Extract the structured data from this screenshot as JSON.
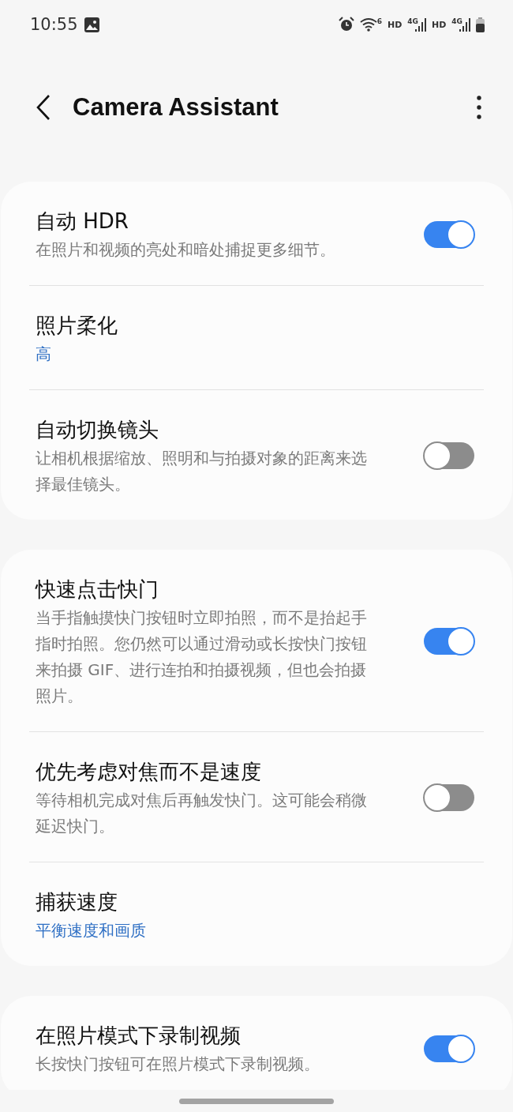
{
  "status_bar": {
    "time": "10:55",
    "wifi_generation": "6",
    "indicators": [
      {
        "kind": "text",
        "text": "HD"
      },
      {
        "kind": "signal",
        "text": "4G"
      },
      {
        "kind": "text",
        "text": "HD"
      },
      {
        "kind": "signal",
        "text": "4G"
      }
    ]
  },
  "header": {
    "title": "Camera Assistant"
  },
  "cards": [
    {
      "rows": [
        {
          "kind": "toggle",
          "title": "自动 HDR",
          "subtitle": "在照片和视频的亮处和暗处捕捉更多细节。",
          "on": true
        },
        {
          "kind": "value",
          "title": "照片柔化",
          "value": "高"
        },
        {
          "kind": "toggle",
          "title": "自动切换镜头",
          "subtitle": "让相机根据缩放、照明和与拍摄对象的距离来选择最佳镜头。",
          "on": false
        }
      ]
    },
    {
      "rows": [
        {
          "kind": "toggle",
          "title": "快速点击快门",
          "subtitle": "当手指触摸快门按钮时立即拍照，而不是抬起手指时拍照。您仍然可以通过滑动或长按快门按钮来拍摄 GIF、进行连拍和拍摄视频，但也会拍摄照片。",
          "on": true
        },
        {
          "kind": "toggle",
          "title": "优先考虑对焦而不是速度",
          "subtitle": "等待相机完成对焦后再触发快门。这可能会稍微延迟快门。",
          "on": false
        },
        {
          "kind": "value",
          "title": "捕获速度",
          "value": "平衡速度和画质"
        }
      ]
    },
    {
      "rows": [
        {
          "kind": "toggle",
          "title": "在照片模式下录制视频",
          "subtitle": "长按快门按钮可在照片模式下录制视频。",
          "on": true
        }
      ]
    }
  ]
}
